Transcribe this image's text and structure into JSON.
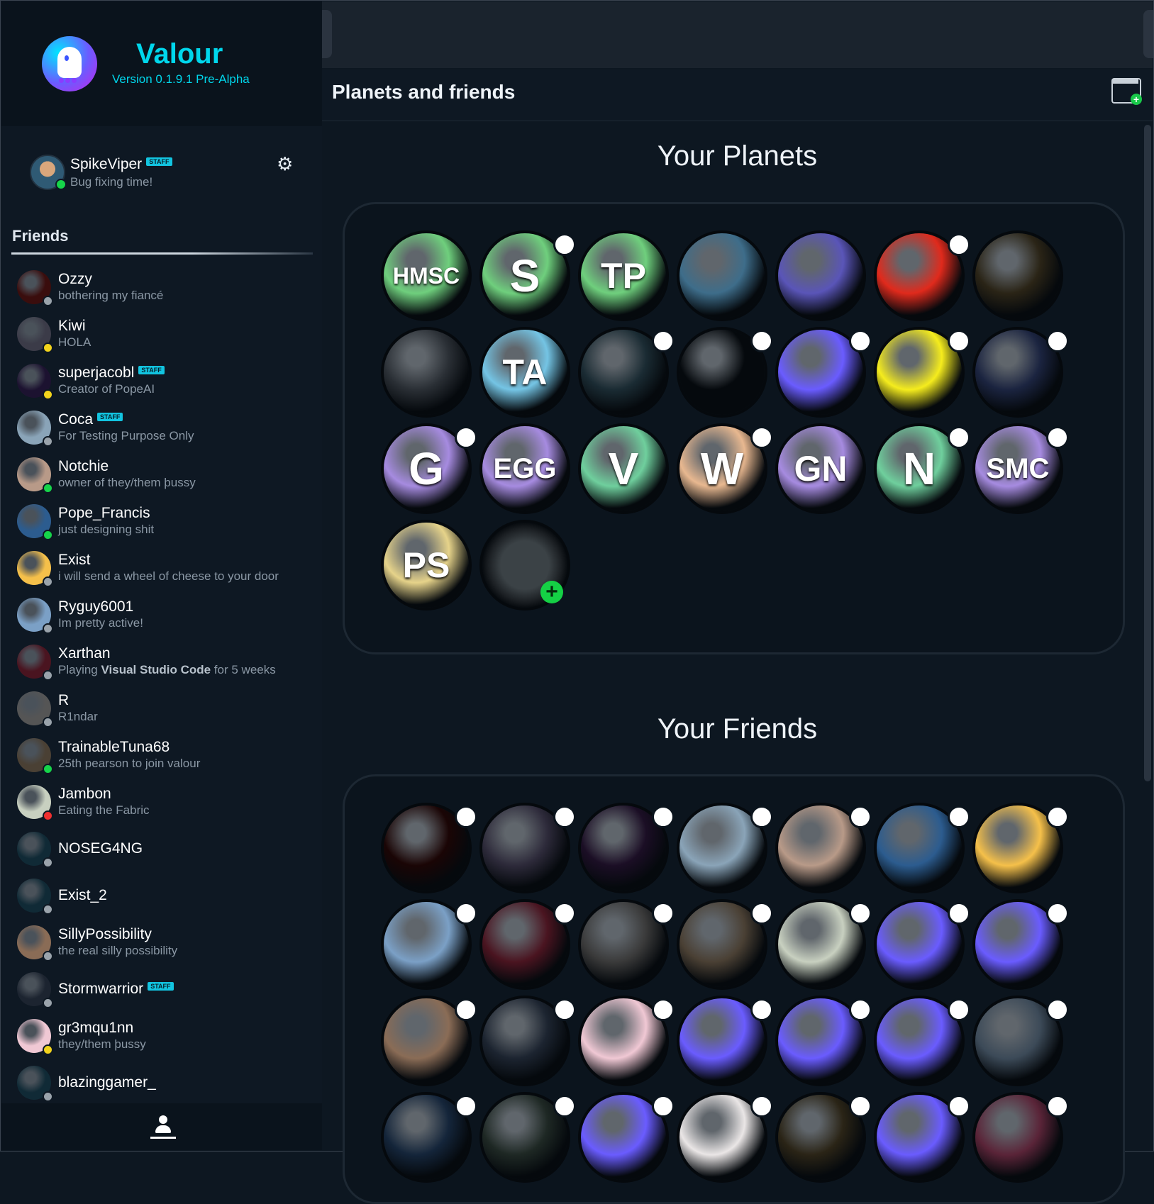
{
  "brand": {
    "title": "Valour",
    "version": "Version 0.1.9.1 Pre-Alpha"
  },
  "me": {
    "name": "SpikeViper",
    "badge": "STAFF",
    "status": "Bug fixing time!"
  },
  "friends_label": "Friends",
  "friends": [
    {
      "name": "Ozzy",
      "sub": "bothering my fiancé",
      "status": "offline"
    },
    {
      "name": "Kiwi",
      "sub": "HOLA",
      "status": "away"
    },
    {
      "name": "superjacobl",
      "badge": "STAFF",
      "sub": "Creator of PopeAI",
      "status": "away"
    },
    {
      "name": "Coca",
      "badge": "STAFF",
      "sub": "For Testing Purpose Only",
      "status": "offline"
    },
    {
      "name": "Notchie",
      "sub": "owner of they/them þussy",
      "status": "online"
    },
    {
      "name": "Pope_Francis",
      "sub": "just designing shit",
      "status": "online"
    },
    {
      "name": "Exist",
      "sub": "i will send a wheel of cheese to your door",
      "status": "offline"
    },
    {
      "name": "Ryguy6001",
      "sub": "Im pretty active!",
      "status": "offline"
    },
    {
      "name": "Xarthan",
      "sub_prefix": "Playing ",
      "sub_bold": "Visual Studio Code",
      "sub_suffix": " for 5 weeks",
      "status": "offline"
    },
    {
      "name": "R",
      "sub": "R1ndar",
      "status": "offline"
    },
    {
      "name": "TrainableTuna68",
      "sub": "25th pearson to join valour",
      "status": "online"
    },
    {
      "name": "Jambon",
      "sub": "Eating the Fabric",
      "status": "busy"
    },
    {
      "name": "NOSEG4NG",
      "sub": "",
      "status": "offline"
    },
    {
      "name": "Exist_2",
      "sub": "",
      "status": "offline"
    },
    {
      "name": "SillyPossibility",
      "sub": "the real silly possibility",
      "status": "offline"
    },
    {
      "name": "Stormwarrior",
      "badge": "STAFF",
      "sub": "",
      "status": "offline"
    },
    {
      "name": "gr3mqu1nn",
      "sub": "they/them þussy",
      "status": "away"
    },
    {
      "name": "blazinggamer_",
      "sub": "",
      "status": "offline"
    }
  ],
  "header": {
    "title": "Planets and friends",
    "new_window_icon": "new-window-icon"
  },
  "planets_title": "Your Planets",
  "friends_title": "Your Friends",
  "planets": [
    {
      "label": "HMSC",
      "color": "#6fcf7d",
      "dot": false
    },
    {
      "label": "S",
      "color": "#6fcf7d",
      "dot": true
    },
    {
      "label": "TP",
      "color": "#6fcf7d",
      "dot": false
    },
    {
      "label": "",
      "image": "kiwi-bird",
      "color": "#3e6d8a",
      "dot": false
    },
    {
      "label": "",
      "image": "red-gear-emblem",
      "color": "#5a55b8",
      "dot": false
    },
    {
      "label": "",
      "image": "german-flag",
      "color": "#e02a1c",
      "dot": true
    },
    {
      "label": "",
      "image": "gold-lightning",
      "color": "#2a2416",
      "dot": false
    },
    {
      "label": "",
      "image": "wireless-8",
      "color": "#2a2f35",
      "dot": false
    },
    {
      "label": "TA",
      "color": "#74c4e4",
      "dot": false
    },
    {
      "label": "",
      "image": "cyan-layers",
      "color": "#1a2b33",
      "dot": true
    },
    {
      "label": "",
      "image": "droplet",
      "color": "#05090d",
      "dot": true
    },
    {
      "label": "",
      "image": "valour-logo",
      "color": "#6a5cff",
      "dot": true
    },
    {
      "label": "",
      "image": "yellow-smile",
      "color": "#f5ec1d",
      "dot": true
    },
    {
      "label": "",
      "image": "flag-tanks",
      "color": "#1b2440",
      "dot": true
    },
    {
      "label": "G",
      "color": "#a68be0",
      "dot": true
    },
    {
      "label": "EGG",
      "color": "#a68be0",
      "dot": false
    },
    {
      "label": "V",
      "color": "#6fcf9d",
      "dot": false
    },
    {
      "label": "W",
      "color": "#e8b890",
      "dot": true
    },
    {
      "label": "GN",
      "color": "#a68be0",
      "dot": false
    },
    {
      "label": "N",
      "color": "#6fcf9d",
      "dot": true
    },
    {
      "label": "SMC",
      "color": "#a68be0",
      "dot": true
    },
    {
      "label": "PS",
      "color": "#e6d38a",
      "dot": false
    },
    {
      "label": "",
      "image": "add-planet",
      "color": "#2e3438",
      "dot": false,
      "add": true
    }
  ],
  "friend_tiles": [
    {
      "image": "red-cracks",
      "color": "#1a0505",
      "dot": true
    },
    {
      "image": "plague-doctor",
      "color": "#2d2a3a",
      "dot": true
    },
    {
      "image": "pixel-figure",
      "color": "#1b0e25",
      "dot": true
    },
    {
      "image": "red-balloon-beach",
      "color": "#8aa4b8",
      "dot": true
    },
    {
      "image": "elderly-face",
      "color": "#b89a88",
      "dot": true
    },
    {
      "image": "portrait-tux",
      "color": "#2c5c8f",
      "dot": true
    },
    {
      "image": "yellow-smile-chick",
      "color": "#f5c04a",
      "dot": true
    },
    {
      "image": "anime-sky",
      "color": "#7ba0c6",
      "dot": true
    },
    {
      "image": "red-owl",
      "color": "#4a1420",
      "dot": true
    },
    {
      "image": "moon-surface",
      "color": "#3a3a3a",
      "dot": true
    },
    {
      "image": "costume-photo",
      "color": "#4a4034",
      "dot": true
    },
    {
      "image": "red-green-grid",
      "color": "#c8d0c0",
      "dot": true
    },
    {
      "image": "valour-logo",
      "color": "#6a5cff",
      "dot": true
    },
    {
      "image": "valour-logo",
      "color": "#6a5cff",
      "dot": true
    },
    {
      "image": "glasses-selfie",
      "color": "#8a6c56",
      "dot": true
    },
    {
      "image": "sw-logo",
      "color": "#1c2430",
      "dot": true
    },
    {
      "image": "pink-anime",
      "color": "#f0c8d4",
      "dot": true
    },
    {
      "image": "valour-logo",
      "color": "#6a5cff",
      "dot": true
    },
    {
      "image": "valour-logo",
      "color": "#6a5cff",
      "dot": true
    },
    {
      "image": "valour-logo",
      "color": "#6a5cff",
      "dot": true
    },
    {
      "image": "sea-portrait",
      "color": "#3c4a58",
      "dot": true
    },
    {
      "image": "dark-blue",
      "color": "#14253a",
      "dot": true
    },
    {
      "image": "dark-face",
      "color": "#1e2824",
      "dot": true
    },
    {
      "image": "valour-logo",
      "color": "#6a5cff",
      "dot": true
    },
    {
      "image": "white-anime",
      "color": "#eae6e6",
      "dot": true
    },
    {
      "image": "blond-figure",
      "color": "#2a2416",
      "dot": true
    },
    {
      "image": "valour-logo",
      "color": "#6a5cff",
      "dot": true
    },
    {
      "image": "purple-hood",
      "color": "#5a2438",
      "dot": true
    }
  ],
  "status_colors": {
    "online": "#16d44a",
    "away": "#f2d31c",
    "busy": "#ef3030",
    "offline": "#9aa3ab"
  },
  "accent": "#00d7ec"
}
